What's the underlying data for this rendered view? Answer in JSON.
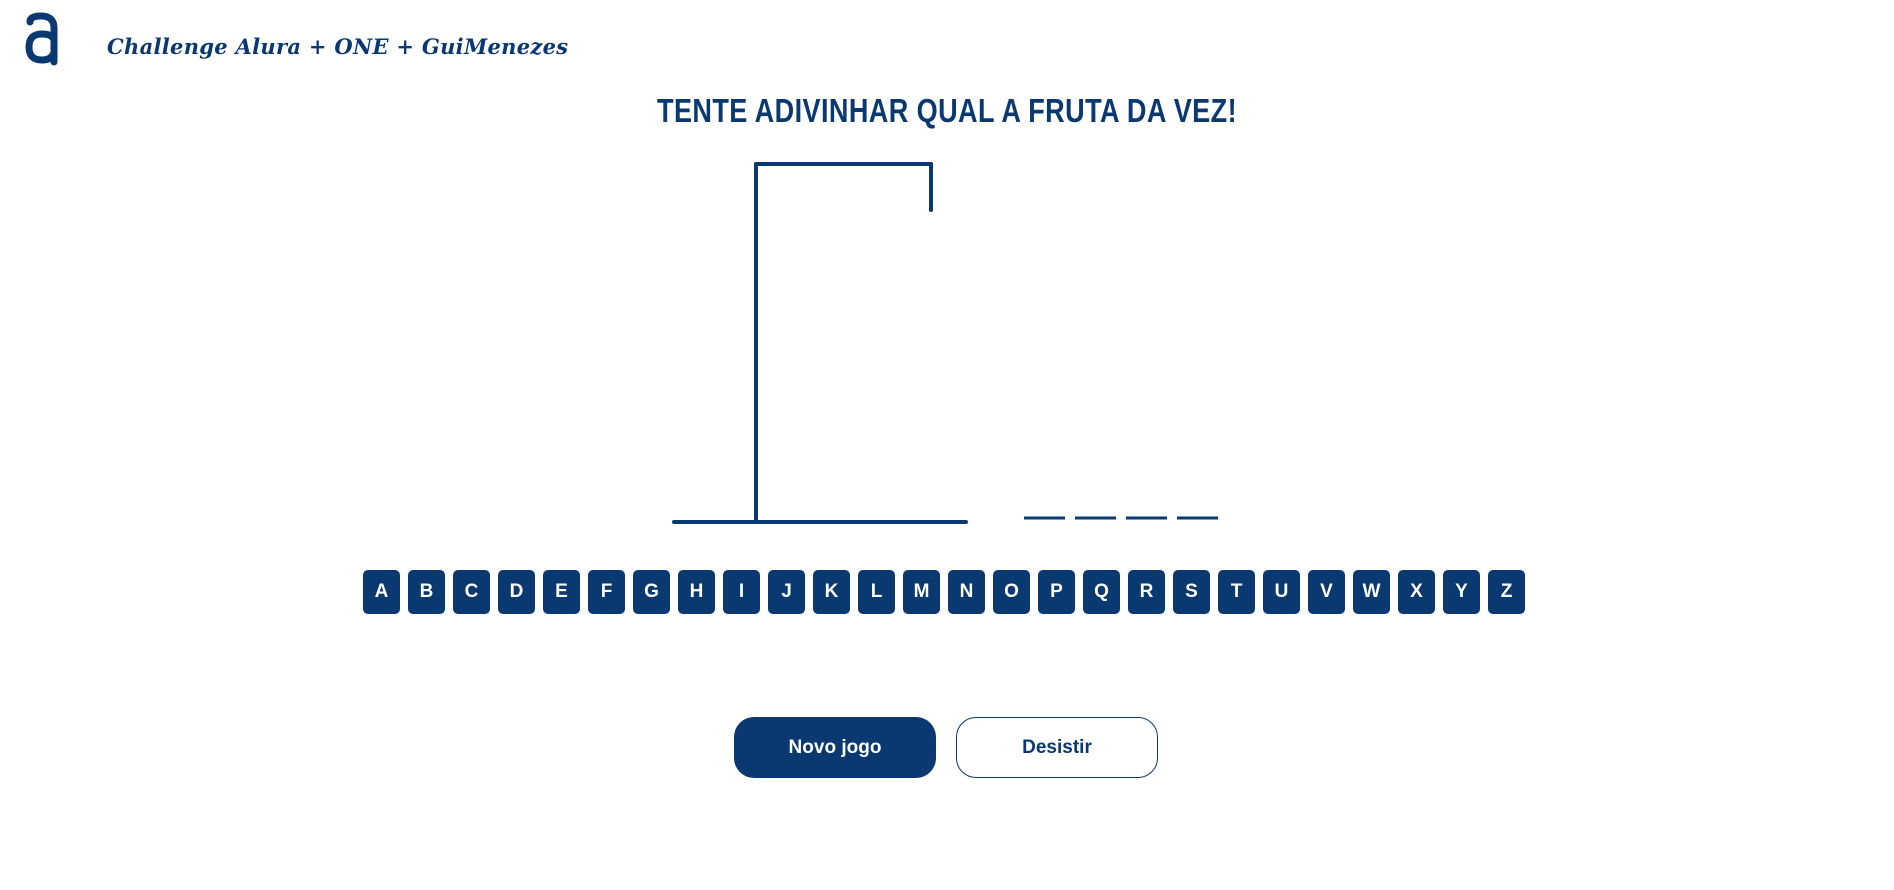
{
  "header": {
    "logo_icon": "alura-logo-icon",
    "title": "Challenge Alura + ONE +  GuiMenezes"
  },
  "game": {
    "headline": "TENTE ADIVINHAR QUAL A FRUTA DA VEZ!",
    "word_length": 4,
    "letters": [
      "A",
      "B",
      "C",
      "D",
      "E",
      "F",
      "G",
      "H",
      "I",
      "J",
      "K",
      "L",
      "M",
      "N",
      "O",
      "P",
      "Q",
      "R",
      "S",
      "T",
      "U",
      "V",
      "W",
      "X",
      "Y",
      "Z"
    ]
  },
  "actions": {
    "new_game_label": "Novo jogo",
    "give_up_label": "Desistir"
  },
  "colors": {
    "primary": "#0a3871",
    "background": "#ffffff"
  }
}
